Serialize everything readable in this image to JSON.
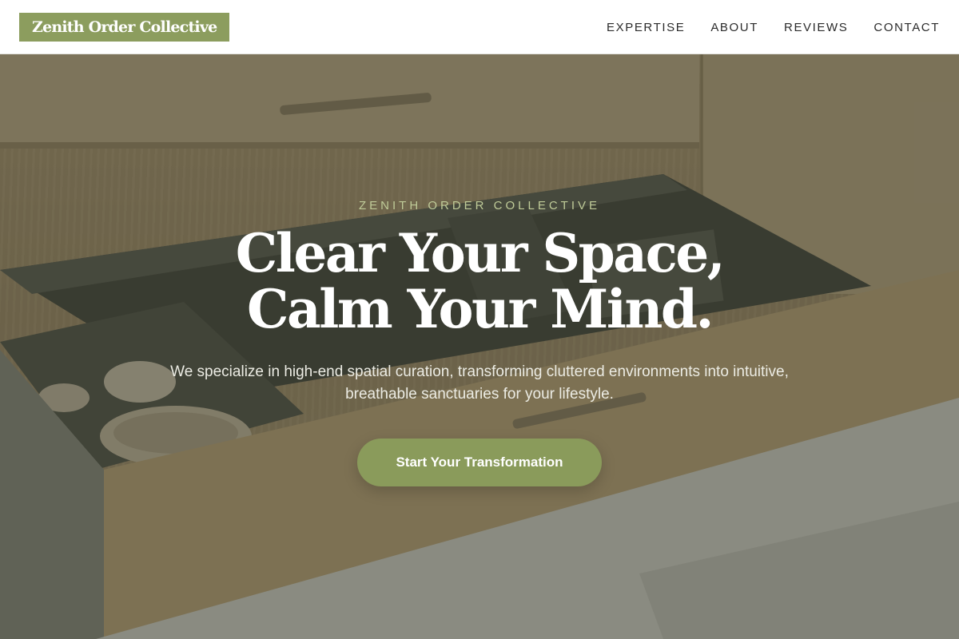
{
  "header": {
    "logo_text": "Zenith Order Collective",
    "nav": [
      {
        "label": "EXPERTISE"
      },
      {
        "label": "ABOUT"
      },
      {
        "label": "REVIEWS"
      },
      {
        "label": "CONTACT"
      }
    ]
  },
  "hero": {
    "eyebrow": "ZENITH ORDER COLLECTIVE",
    "headline_line1": "Clear Your Space,",
    "headline_line2": "Calm Your Mind.",
    "subtext": "We specialize in high-end spatial curation, transforming cluttered environments into intuitive, breathable sanctuaries for your lifestyle.",
    "cta_label": "Start Your Transformation",
    "background_image_subject": "open kitchen drawer with organized bowls and cutlery"
  },
  "colors": {
    "brand_green": "#8c9d5e",
    "eyebrow_green": "#bfcb98",
    "header_bg": "#ffffff",
    "nav_text": "#2b2b2b"
  }
}
